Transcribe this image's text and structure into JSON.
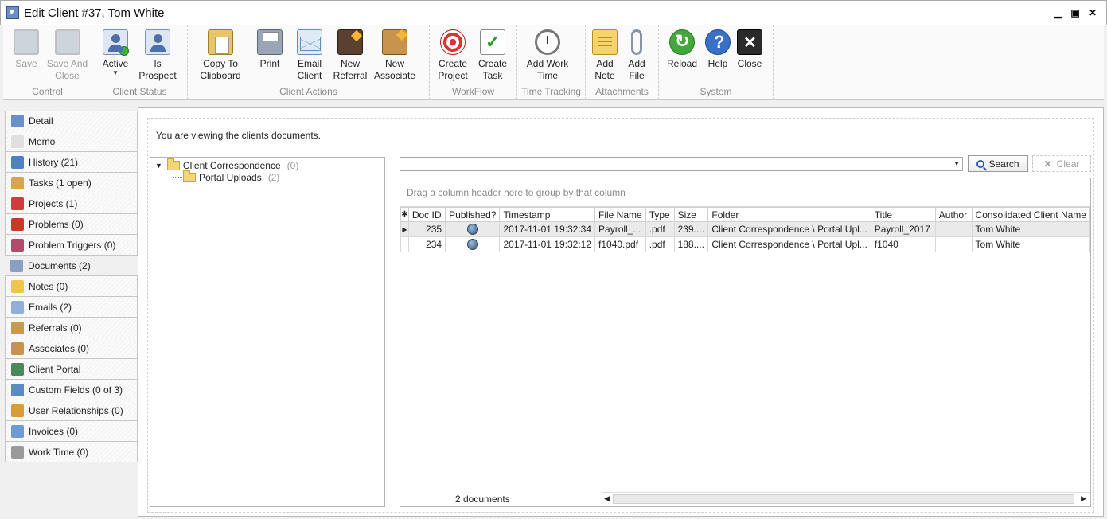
{
  "window": {
    "title": "Edit Client #37, Tom White"
  },
  "ribbon": {
    "groups": [
      {
        "label": "Control",
        "buttons": [
          {
            "label": "Save"
          },
          {
            "label": "Save And Close"
          }
        ]
      },
      {
        "label": "Client Status",
        "buttons": [
          {
            "label": "Active"
          },
          {
            "label": "Is Prospect"
          }
        ]
      },
      {
        "label": "Client Actions",
        "buttons": [
          {
            "label": "Copy To Clipboard"
          },
          {
            "label": "Print"
          },
          {
            "label": "Email Client"
          },
          {
            "label": "New Referral"
          },
          {
            "label": "New Associate"
          }
        ]
      },
      {
        "label": "WorkFlow",
        "buttons": [
          {
            "label": "Create Project"
          },
          {
            "label": "Create Task"
          }
        ]
      },
      {
        "label": "Time Tracking",
        "buttons": [
          {
            "label": "Add Work Time"
          }
        ]
      },
      {
        "label": "Attachments",
        "buttons": [
          {
            "label": "Add Note"
          },
          {
            "label": "Add File"
          }
        ]
      },
      {
        "label": "System",
        "buttons": [
          {
            "label": "Reload"
          },
          {
            "label": "Help"
          },
          {
            "label": "Close"
          }
        ]
      }
    ]
  },
  "sidebar": {
    "items": [
      {
        "label": "Detail",
        "icon": "detail-icon",
        "color": "#6b8fc9"
      },
      {
        "label": "Memo",
        "icon": "memo-icon",
        "color": "#e0e0e0"
      },
      {
        "label": "History (21)",
        "icon": "history-icon",
        "color": "#4d83c4"
      },
      {
        "label": "Tasks (1 open)",
        "icon": "tasks-icon",
        "color": "#d7a648"
      },
      {
        "label": "Projects (1)",
        "icon": "projects-icon",
        "color": "#d33b3b"
      },
      {
        "label": "Problems (0)",
        "icon": "problems-icon",
        "color": "#c83a2a"
      },
      {
        "label": "Problem Triggers (0)",
        "icon": "problem-triggers-icon",
        "color": "#b54b6a"
      },
      {
        "label": "Documents (2)",
        "icon": "documents-icon",
        "color": "#8aa0c0"
      },
      {
        "label": "Notes (0)",
        "icon": "notes-icon",
        "color": "#f0c64a"
      },
      {
        "label": "Emails (2)",
        "icon": "emails-icon",
        "color": "#8fb0d8"
      },
      {
        "label": "Referrals (0)",
        "icon": "referrals-icon",
        "color": "#c89a50"
      },
      {
        "label": "Associates (0)",
        "icon": "associates-icon",
        "color": "#c8934d"
      },
      {
        "label": "Client Portal",
        "icon": "client-portal-icon",
        "color": "#4a8a5a"
      },
      {
        "label": "Custom Fields (0 of 3)",
        "icon": "custom-fields-icon",
        "color": "#5a8ac8"
      },
      {
        "label": "User Relationships (0)",
        "icon": "user-relationships-icon",
        "color": "#d99c3a"
      },
      {
        "label": "Invoices (0)",
        "icon": "invoices-icon",
        "color": "#6f9bd3"
      },
      {
        "label": "Work Time (0)",
        "icon": "work-time-icon",
        "color": "#9a9a9a"
      }
    ],
    "selected_index": 7
  },
  "main": {
    "info_text": "You are viewing the clients documents.",
    "tree": {
      "root": {
        "label": "Client Correspondence",
        "count": "(0)"
      },
      "child": {
        "label": "Portal Uploads",
        "count": "(2)"
      }
    },
    "search": {
      "value": "",
      "button_label": "Search",
      "clear_label": "Clear"
    },
    "grid": {
      "group_hint": "Drag a column header here to group by that column",
      "columns": [
        "Doc ID",
        "Published?",
        "Timestamp",
        "File Name",
        "Type",
        "Size",
        "Folder",
        "Title",
        "Author",
        "Consolidated Client Name"
      ],
      "rows": [
        {
          "doc_id": "235",
          "timestamp": "2017-11-01 19:32:34",
          "file_name": "Payroll_...",
          "type": ".pdf",
          "size": "239....",
          "folder": "Client Correspondence \\ Portal Upl...",
          "title": "Payroll_2017",
          "author": "",
          "client": "Tom White"
        },
        {
          "doc_id": "234",
          "timestamp": "2017-11-01 19:32:12",
          "file_name": "f1040.pdf",
          "type": ".pdf",
          "size": "188....",
          "folder": "Client Correspondence \\ Portal Upl...",
          "title": "f1040",
          "author": "",
          "client": "Tom White"
        }
      ],
      "footer_count": "2 documents"
    }
  }
}
